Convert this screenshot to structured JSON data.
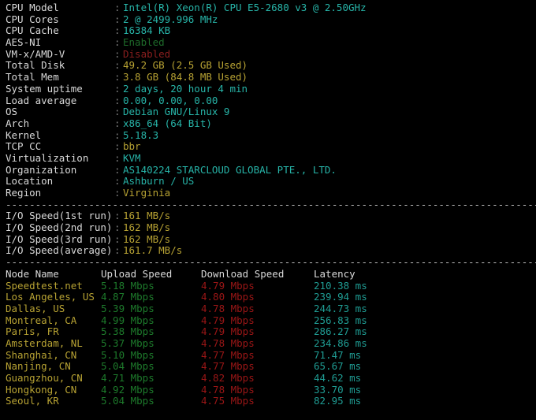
{
  "terminal": {
    "background": "#000000",
    "divider_char": "-",
    "divider_repeat": 97,
    "colors": {
      "label": "#d9d9d9",
      "cyan": "#27b4a8",
      "yellow": "#b7a233",
      "green": "#1e6b2a",
      "red": "#8d1f1f",
      "divider": "#bdbdbd"
    }
  },
  "system_info": {
    "separator": ":",
    "rows": [
      {
        "label": "CPU Model",
        "value": "Intel(R) Xeon(R) CPU E5-2680 v3 @ 2.50GHz",
        "color": "cyan"
      },
      {
        "label": "CPU Cores",
        "value": "2 @ 2499.996 MHz",
        "color": "cyan"
      },
      {
        "label": "CPU Cache",
        "value": "16384 KB",
        "color": "cyan"
      },
      {
        "label": "AES-NI",
        "value": "Enabled",
        "color": "green"
      },
      {
        "label": "VM-x/AMD-V",
        "value": "Disabled",
        "color": "red"
      },
      {
        "label": "Total Disk",
        "value": "49.2 GB (2.5 GB Used)",
        "color": "yellow"
      },
      {
        "label": "Total Mem",
        "value": "3.8 GB (84.8 MB Used)",
        "color": "yellow"
      },
      {
        "label": "System uptime",
        "value": "2 days, 20 hour 4 min",
        "color": "cyan"
      },
      {
        "label": "Load average",
        "value": "0.00, 0.00, 0.00",
        "color": "cyan"
      },
      {
        "label": "OS",
        "value": "Debian GNU/Linux 9",
        "color": "cyan"
      },
      {
        "label": "Arch",
        "value": "x86_64 (64 Bit)",
        "color": "cyan"
      },
      {
        "label": "Kernel",
        "value": "5.18.3",
        "color": "cyan"
      },
      {
        "label": "TCP CC",
        "value": "bbr",
        "color": "yellow"
      },
      {
        "label": "Virtualization",
        "value": "KVM",
        "color": "cyan"
      },
      {
        "label": "Organization",
        "value": "AS140224 STARCLOUD GLOBAL PTE., LTD.",
        "color": "cyan"
      },
      {
        "label": "Location",
        "value": "Ashburn / US",
        "color": "cyan"
      },
      {
        "label": "Region",
        "value": "Virginia",
        "color": "yellow"
      }
    ]
  },
  "io_speed": {
    "separator": ":",
    "rows": [
      {
        "label": "I/O Speed(1st run)",
        "value": "161 MB/s",
        "color": "yellow"
      },
      {
        "label": "I/O Speed(2nd run)",
        "value": "162 MB/s",
        "color": "yellow"
      },
      {
        "label": "I/O Speed(3rd run)",
        "value": "162 MB/s",
        "color": "yellow"
      },
      {
        "label": "I/O Speed(average)",
        "value": "161.7 MB/s",
        "color": "yellow"
      }
    ]
  },
  "speedtest": {
    "headers": {
      "node": "Node Name",
      "upload": "Upload Speed",
      "download": "Download Speed",
      "latency": "Latency"
    },
    "rows": [
      {
        "node": "Speedtest.net",
        "upload": "5.18 Mbps",
        "download": "4.79 Mbps",
        "latency": "210.38 ms"
      },
      {
        "node": "Los Angeles, US",
        "upload": "4.87 Mbps",
        "download": "4.80 Mbps",
        "latency": "239.94 ms"
      },
      {
        "node": "Dallas, US",
        "upload": "5.39 Mbps",
        "download": "4.78 Mbps",
        "latency": "244.73 ms"
      },
      {
        "node": "Montreal, CA",
        "upload": "4.99 Mbps",
        "download": "4.79 Mbps",
        "latency": "256.83 ms"
      },
      {
        "node": "Paris, FR",
        "upload": "5.38 Mbps",
        "download": "4.79 Mbps",
        "latency": "286.27 ms"
      },
      {
        "node": "Amsterdam, NL",
        "upload": "5.37 Mbps",
        "download": "4.78 Mbps",
        "latency": "234.86 ms"
      },
      {
        "node": "Shanghai, CN",
        "upload": "5.10 Mbps",
        "download": "4.77 Mbps",
        "latency": "71.47 ms"
      },
      {
        "node": "Nanjing, CN",
        "upload": "5.04 Mbps",
        "download": "4.77 Mbps",
        "latency": "65.67 ms"
      },
      {
        "node": "Guangzhou, CN",
        "upload": "4.71 Mbps",
        "download": "4.82 Mbps",
        "latency": "44.62 ms"
      },
      {
        "node": "Hongkong, CN",
        "upload": "4.92 Mbps",
        "download": "4.78 Mbps",
        "latency": "33.70 ms"
      },
      {
        "node": "Seoul, KR",
        "upload": "5.04 Mbps",
        "download": "4.75 Mbps",
        "latency": "82.95 ms"
      }
    ]
  }
}
